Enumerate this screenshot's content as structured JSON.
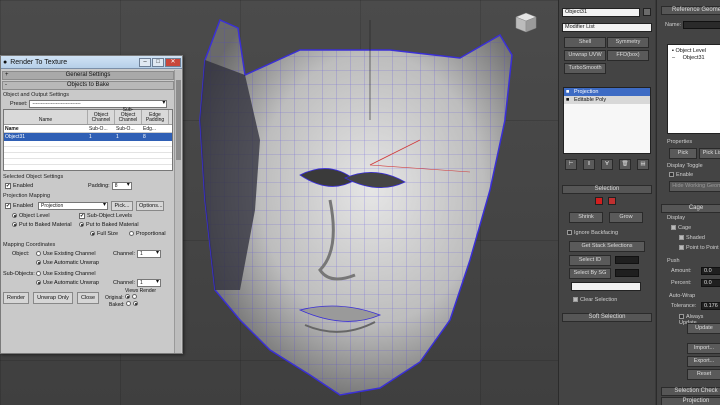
{
  "render_to_texture": {
    "title": "Render To Texture",
    "rollouts": {
      "general": "General Settings",
      "objects_to_bake": "Objects to Bake"
    },
    "object_output": {
      "label": "Object and Output Settings",
      "preset_label": "Preset:",
      "preset_value": "-----------------------------",
      "columns": [
        "Name",
        "Object Channel",
        "Sub-Object Channel",
        "Edge Padding"
      ],
      "selected_row": [
        "Name",
        "Sub-O...",
        "Sub-O...",
        "Edg..."
      ],
      "data_row": [
        "Object31",
        "1",
        "1",
        "8"
      ]
    },
    "selected_object_settings": {
      "label": "Selected Object Settings",
      "enabled_label": "Enabled",
      "padding_label": "Padding:",
      "padding_value": "8"
    },
    "projection_mapping": {
      "label": "Projection Mapping",
      "enabled_label": "Enabled",
      "projection_value": "Projection",
      "pick_label": "Pick...",
      "options_label": "Options...",
      "object_level": "Object Level",
      "sub_object_levels": "Sub-Object Levels",
      "put_to_baked_1": "Put to Baked Material",
      "put_to_baked_2": "Put to Baked Material",
      "full_size": "Full Size",
      "proportional": "Proportional"
    },
    "mapping_coordinates": {
      "label": "Mapping Coordinates",
      "object_label": "Object:",
      "object_opt1": "Use Existing Channel",
      "object_opt2": "Use Automatic Unwrap",
      "channel_label": "Channel:",
      "channel_value": "1",
      "subobjects_label": "Sub-Objects:",
      "sub_opt1": "Use Existing Channel",
      "sub_opt2": "Use Automatic Unwrap",
      "sub_channel_label": "Channel:",
      "sub_channel_value": "1"
    },
    "footer": {
      "render": "Render",
      "unwrap_only": "Unwrap Only",
      "close": "Close",
      "original": "Original:",
      "baked": "Baked:",
      "views": "Views",
      "render_label": "Render"
    }
  },
  "command_panel": {
    "object_name": "Object31",
    "modifier_list": "Modifier List",
    "buttons": [
      "Shell",
      "Symmetry",
      "Unwrap UVW",
      "FFD(box)",
      "TurboSmooth"
    ],
    "stack": [
      "Projection",
      "Editable Poly"
    ],
    "selection_rollout": "Selection",
    "shrink": "Shrink",
    "grow": "Grow",
    "ignore_backfacing": "Ignore Backfacing",
    "get_stack_selections": "Get Stack Selections",
    "select_id": "Select ID",
    "select_by_smg": "Select By SG",
    "clear_selection": "Clear Selection",
    "soft_selection": "Soft Selection"
  },
  "reference_panel": {
    "title": "Reference Geometry",
    "name_label": "Name:",
    "object_level": "Object Level",
    "object31": "Object31",
    "properties": "Properties",
    "pick": "Pick",
    "pick_list": "Pick List",
    "display_toggle": "Display Toggle",
    "enable": "Enable",
    "hide_working_geom": "Hide Working Geom",
    "cage": "Cage",
    "display": "Display",
    "cage_chk": "Cage",
    "shaded": "Shaded",
    "point_to_point": "Point to Point",
    "push": "Push",
    "amount_label": "Amount:",
    "amount_value": "0.0",
    "percent_label": "Percent:",
    "percent_value": "0.0",
    "auto_wrap": "Auto-Wrap",
    "tolerance_label": "Tolerance:",
    "tolerance_value": "0.176",
    "always_update": "Always Update",
    "update": "Update",
    "import": "Import...",
    "export": "Export...",
    "reset": "Reset",
    "selection_check": "Selection Check",
    "projection": "Projection"
  },
  "colors": {
    "selection_blue": "#3d6bc4",
    "wire_blue": "#3a2fd6",
    "red_swatch": "#d21f1f"
  }
}
